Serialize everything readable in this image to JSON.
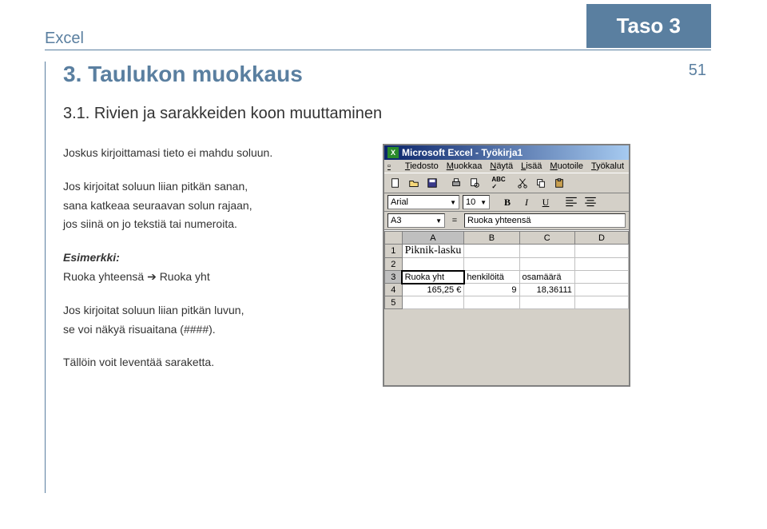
{
  "header": {
    "app": "Excel",
    "level": "Taso 3",
    "page_number": "51"
  },
  "section": {
    "title": "3. Taulukon muokkaus",
    "subtitle": "3.1. Rivien ja sarakkeiden koon muuttaminen"
  },
  "body": {
    "p1": "Joskus kirjoittamasi tieto ei mahdu soluun.",
    "p2_l1": "Jos kirjoitat soluun liian pitkän sanan,",
    "p2_l2": "sana katkeaa seuraavan solun rajaan,",
    "p2_l3": "jos siinä on jo tekstiä tai numeroita.",
    "example_heading": "Esimerkki:",
    "example_line": "Ruoka yhteensä ➔ Ruoka yht",
    "p3_l1": "Jos kirjoitat soluun liian pitkän luvun,",
    "p3_l2": "se voi näkyä risuaitana (####).",
    "p4": "Tällöin voit leventää saraketta."
  },
  "excel": {
    "title": "Microsoft Excel - Työkirja1",
    "menus": [
      "Tiedosto",
      "Muokkaa",
      "Näytä",
      "Lisää",
      "Muotoile",
      "Työkalut"
    ],
    "font_name": "Arial",
    "font_size": "10",
    "namebox": "A3",
    "formula_value": "Ruoka yhteensä",
    "columns": [
      "A",
      "B",
      "C",
      "D"
    ],
    "rows": [
      {
        "n": "1",
        "cells": [
          "Piknik-lasku",
          "",
          "",
          ""
        ]
      },
      {
        "n": "2",
        "cells": [
          "",
          "",
          "",
          ""
        ]
      },
      {
        "n": "3",
        "cells": [
          "Ruoka yht",
          "henkilöitä",
          "osamäärä",
          ""
        ],
        "selected": 0
      },
      {
        "n": "4",
        "cells": [
          "165,25 €",
          "9",
          "18,36111",
          ""
        ],
        "numeric": [
          0,
          1,
          2
        ]
      },
      {
        "n": "5",
        "cells": [
          "",
          "",
          "",
          ""
        ]
      }
    ]
  }
}
